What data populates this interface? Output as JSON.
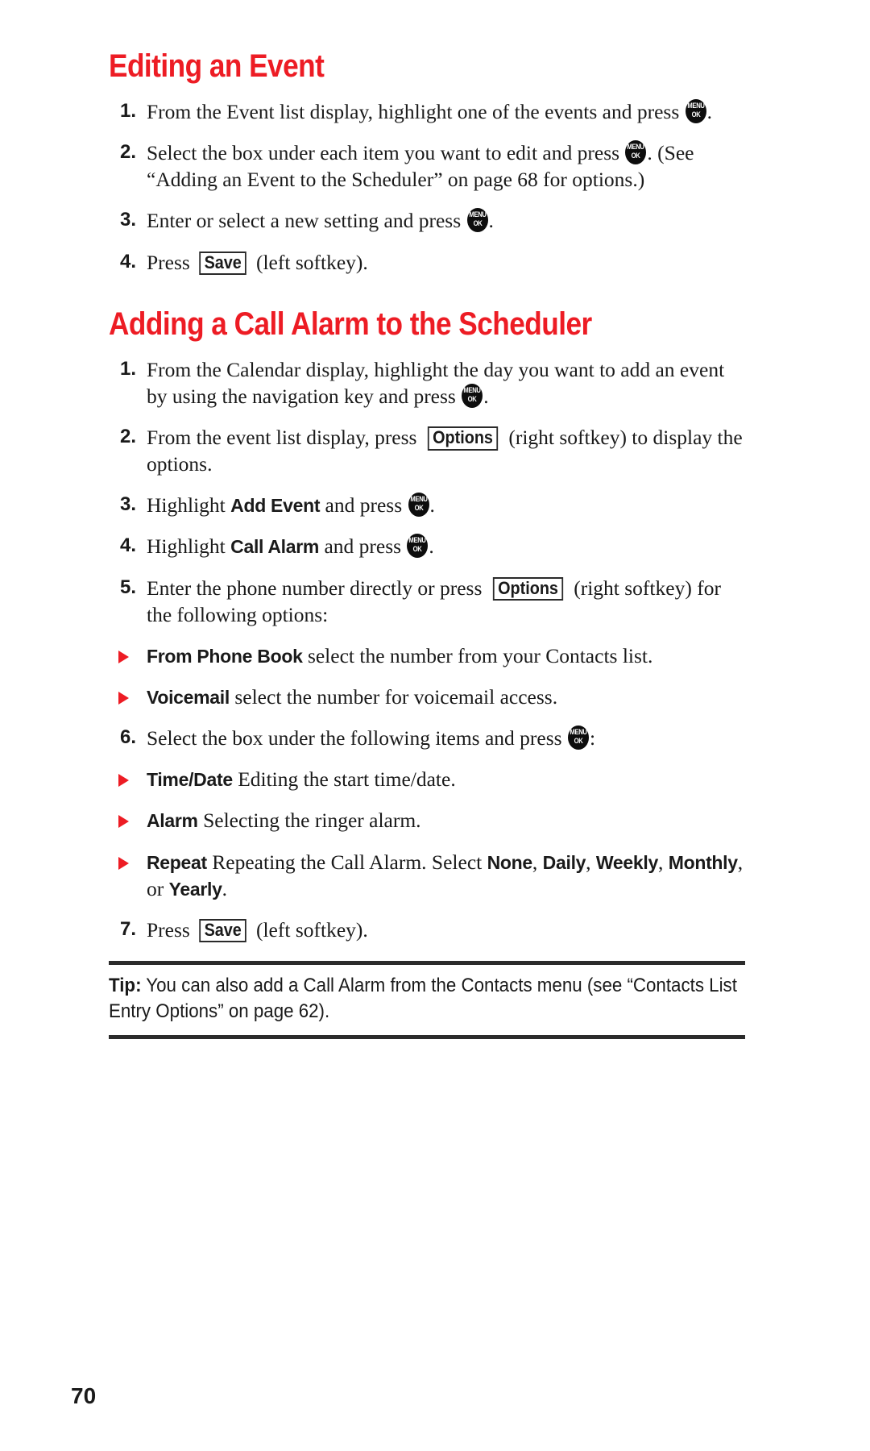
{
  "page": {
    "number": "70",
    "accent_color": "#ed1c24",
    "text_color": "#1a1a1a"
  },
  "section1": {
    "heading": "Editing an Event",
    "steps": [
      {
        "num": "1.",
        "parts": [
          {
            "t": "text",
            "v": "From the Event list display, highlight one of the events and press "
          },
          {
            "t": "menukey",
            "v": "MENU OK"
          },
          {
            "t": "text",
            "v": "."
          }
        ]
      },
      {
        "num": "2.",
        "parts": [
          {
            "t": "text",
            "v": "Select the box under each item you want to edit and press "
          },
          {
            "t": "menukey",
            "v": "MENU OK"
          },
          {
            "t": "text",
            "v": ". (See “Adding an Event to the Scheduler” on page 68 for options.)"
          }
        ]
      },
      {
        "num": "3.",
        "parts": [
          {
            "t": "text",
            "v": "Enter or select a new setting and press "
          },
          {
            "t": "menukey",
            "v": "MENU OK"
          },
          {
            "t": "text",
            "v": "."
          }
        ]
      },
      {
        "num": "4.",
        "parts": [
          {
            "t": "text",
            "v": "Press "
          },
          {
            "t": "softkey",
            "v": "Save"
          },
          {
            "t": "text",
            "v": " (left softkey)."
          }
        ]
      }
    ]
  },
  "section2": {
    "heading": "Adding a Call Alarm to the Scheduler",
    "steps": [
      {
        "num": "1.",
        "parts": [
          {
            "t": "text",
            "v": "From the Calendar display, highlight the day you want to add an event by using the navigation key and press "
          },
          {
            "t": "menukey",
            "v": "MENU OK"
          },
          {
            "t": "text",
            "v": "."
          }
        ]
      },
      {
        "num": "2.",
        "parts": [
          {
            "t": "text",
            "v": "From the event list display, press "
          },
          {
            "t": "softkey",
            "v": "Options"
          },
          {
            "t": "text",
            "v": " (right softkey) to display the options."
          }
        ]
      },
      {
        "num": "3.",
        "parts": [
          {
            "t": "text",
            "v": "Highlight "
          },
          {
            "t": "uiterm",
            "v": "Add Event"
          },
          {
            "t": "text",
            "v": " and press "
          },
          {
            "t": "menukey",
            "v": "MENU OK"
          },
          {
            "t": "text",
            "v": "."
          }
        ]
      },
      {
        "num": "4.",
        "parts": [
          {
            "t": "text",
            "v": "Highlight "
          },
          {
            "t": "uiterm",
            "v": "Call Alarm"
          },
          {
            "t": "text",
            "v": " and press "
          },
          {
            "t": "menukey",
            "v": "MENU OK"
          },
          {
            "t": "text",
            "v": "."
          }
        ]
      },
      {
        "num": "5.",
        "parts": [
          {
            "t": "text",
            "v": "Enter the phone number directly or press "
          },
          {
            "t": "softkey",
            "v": "Options"
          },
          {
            "t": "text",
            "v": " (right softkey) for the following options:"
          }
        ]
      }
    ],
    "bullets_a": [
      {
        "parts": [
          {
            "t": "uiterm",
            "v": "From Phone Book"
          },
          {
            "t": "text",
            "v": " select the number from your Contacts list."
          }
        ]
      },
      {
        "parts": [
          {
            "t": "uiterm",
            "v": "Voicemail"
          },
          {
            "t": "text",
            "v": " select the number for voicemail access."
          }
        ]
      }
    ],
    "step6": {
      "num": "6.",
      "parts": [
        {
          "t": "text",
          "v": "Select the box under the following items and press "
        },
        {
          "t": "menukey",
          "v": "MENU OK"
        },
        {
          "t": "text",
          "v": ":"
        }
      ]
    },
    "bullets_b": [
      {
        "parts": [
          {
            "t": "uiterm",
            "v": "Time/Date"
          },
          {
            "t": "text",
            "v": " Editing the start time/date."
          }
        ]
      },
      {
        "parts": [
          {
            "t": "uiterm",
            "v": "Alarm"
          },
          {
            "t": "text",
            "v": " Selecting the ringer alarm."
          }
        ]
      },
      {
        "parts": [
          {
            "t": "uiterm",
            "v": "Repeat"
          },
          {
            "t": "text",
            "v": " Repeating the Call Alarm. Select "
          },
          {
            "t": "uiterm",
            "v": "None"
          },
          {
            "t": "text",
            "v": ", "
          },
          {
            "t": "uiterm",
            "v": "Daily"
          },
          {
            "t": "text",
            "v": ", "
          },
          {
            "t": "uiterm",
            "v": "Weekly"
          },
          {
            "t": "text",
            "v": ", "
          },
          {
            "t": "uiterm",
            "v": "Monthly"
          },
          {
            "t": "text",
            "v": ", or "
          },
          {
            "t": "uiterm",
            "v": "Yearly"
          },
          {
            "t": "text",
            "v": "."
          }
        ]
      }
    ],
    "step7": {
      "num": "7.",
      "parts": [
        {
          "t": "text",
          "v": "Press "
        },
        {
          "t": "softkey",
          "v": "Save"
        },
        {
          "t": "text",
          "v": " (left softkey)."
        }
      ]
    }
  },
  "tip": {
    "label": "Tip:",
    "text": " You can also add a Call Alarm from the Contacts menu (see “Contacts List Entry Options” on page 62)."
  },
  "icons": {
    "menu_ok": {
      "line1": "MENU",
      "line2": "OK"
    },
    "bullet_arrow": "triangle-right-icon"
  }
}
